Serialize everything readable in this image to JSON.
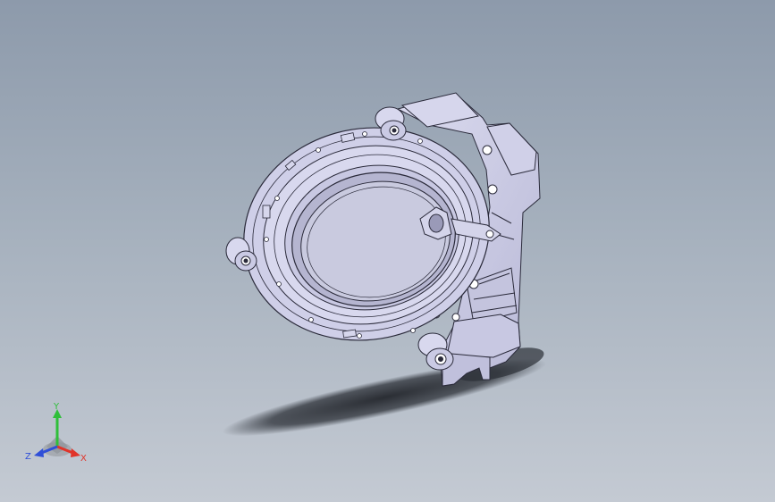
{
  "viewport": {
    "background_top": "#8d9aab",
    "background_bottom": "#c4cad3",
    "model_fill": "#c9c9e4",
    "model_edge": "#2a2a3a",
    "shadow": "#2b2f36"
  },
  "triad": {
    "x_label": "X",
    "y_label": "Y",
    "z_label": "Z",
    "x_color": "#e0342a",
    "y_color": "#2fbf3a",
    "z_color": "#2f4fd8"
  }
}
